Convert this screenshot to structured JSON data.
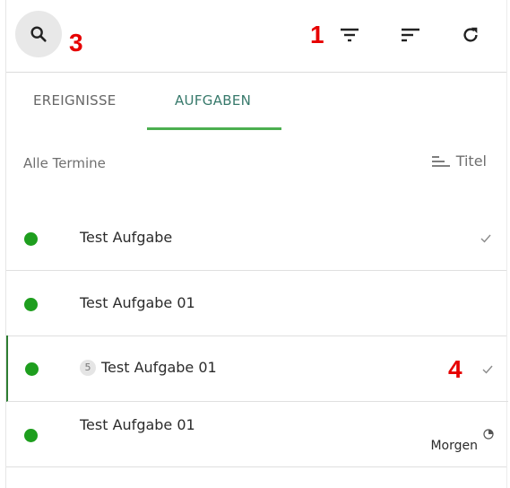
{
  "toolbar": {
    "icons": [
      "search-icon",
      "filter-icon",
      "sort-icon",
      "refresh-icon"
    ]
  },
  "annotations": [
    "1",
    "3",
    "4"
  ],
  "tabs": [
    {
      "label": "EREIGNISSE",
      "active": false
    },
    {
      "label": "AUFGABEN",
      "active": true
    }
  ],
  "filter": {
    "label": "Alle Termine",
    "sort_label": "Titel"
  },
  "tasks": [
    {
      "title": "Test Aufgabe",
      "status": "done"
    },
    {
      "title": "Test Aufgabe 01",
      "status": "open"
    },
    {
      "title": "Test Aufgabe 01",
      "badge": "5",
      "status": "done",
      "selected": true
    },
    {
      "title": "Test Aufgabe 01",
      "due": "Morgen",
      "status": "in-progress"
    }
  ],
  "colors": {
    "accent": "#4caf50",
    "tab_active": "#37796b",
    "status_dot": "#1e9e1e",
    "annotation": "#e60000",
    "selected_border": "#2e7d32"
  }
}
